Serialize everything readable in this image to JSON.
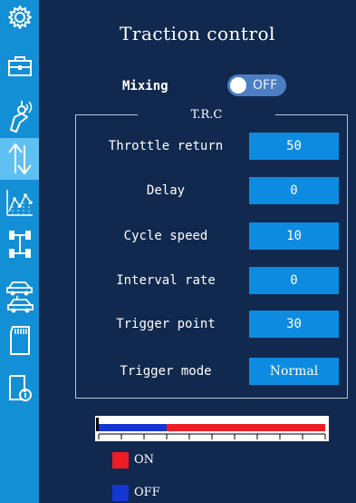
{
  "header": {
    "title": "Traction control"
  },
  "mixing": {
    "label": "Mixing",
    "state": "OFF"
  },
  "trc": {
    "title": "T.R.C",
    "rows": [
      {
        "label": "Throttle return",
        "value": "50"
      },
      {
        "label": "Delay",
        "value": "0"
      },
      {
        "label": "Cycle speed",
        "value": "10"
      },
      {
        "label": "Interval rate",
        "value": "0"
      },
      {
        "label": "Trigger point",
        "value": "30"
      },
      {
        "label": "Trigger mode",
        "value": "Normal"
      }
    ]
  },
  "monitor": {
    "off_fraction": 0.3,
    "on_color": "#ee1c24",
    "off_color": "#1436d2"
  },
  "legend": {
    "on": {
      "label": "ON",
      "color": "#ee1c24"
    },
    "off": {
      "label": "OFF",
      "color": "#1436d2"
    }
  },
  "sidebar": {
    "icons": [
      "gear-icon",
      "toolbox-icon",
      "transmitter-icon",
      "updown-arrows-icon",
      "curve-chart-icon",
      "axle-icon",
      "cars-swap-icon",
      "sd-card-icon",
      "info-book-icon"
    ],
    "active_index": 3,
    "accent_color": "#138fd6"
  }
}
